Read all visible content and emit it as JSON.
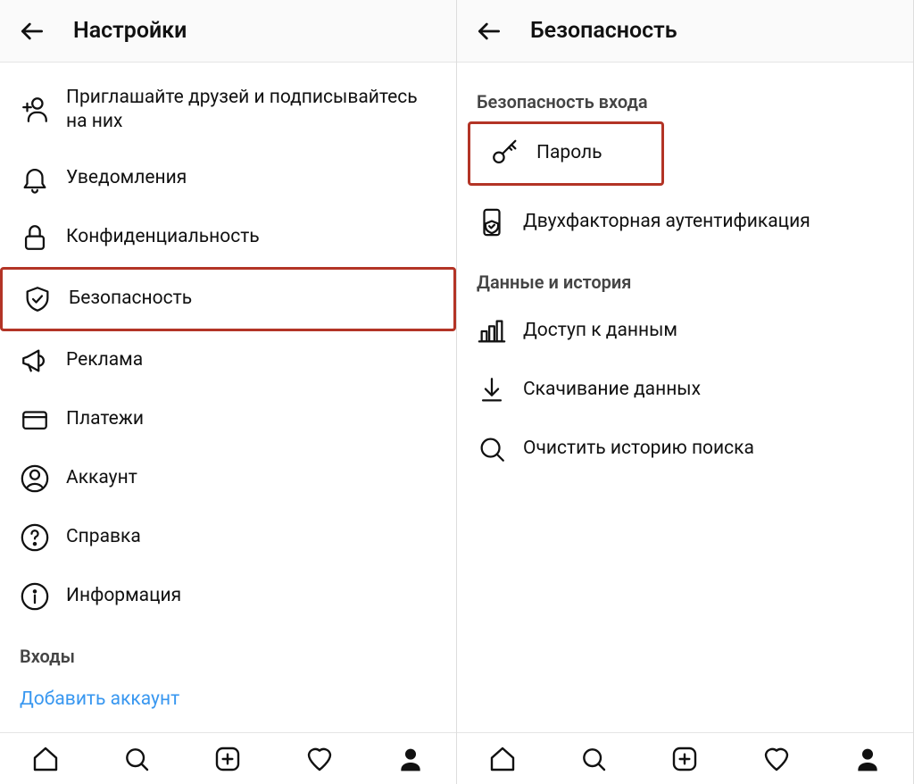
{
  "left": {
    "header_title": "Настройки",
    "items": {
      "invite": "Приглашайте друзей и подписывайтесь на них",
      "notifications": "Уведомления",
      "privacy": "Конфиденциальность",
      "security": "Безопасность",
      "ads": "Реклама",
      "payments": "Платежи",
      "account": "Аккаунт",
      "help": "Справка",
      "info": "Информация"
    },
    "logins_heading": "Входы",
    "add_account": "Добавить аккаунт"
  },
  "right": {
    "header_title": "Безопасность",
    "section_login": "Безопасность входа",
    "items_login": {
      "password": "Пароль",
      "two_factor": "Двухфакторная аутентификация"
    },
    "section_data": "Данные и история",
    "items_data": {
      "data_access": "Доступ к данным",
      "download": "Скачивание данных",
      "clear_search": "Очистить историю поиска"
    }
  }
}
